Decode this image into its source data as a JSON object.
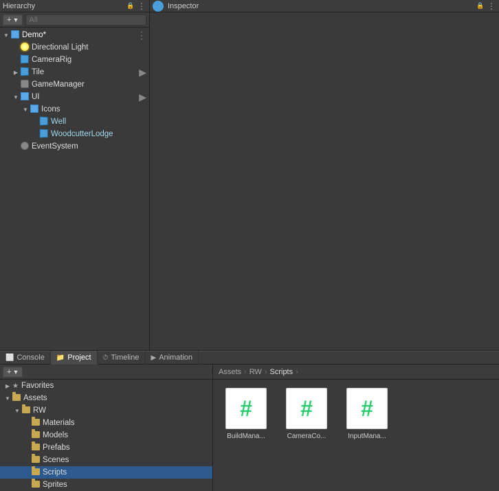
{
  "hierarchy": {
    "title": "Hierarchy",
    "search_placeholder": "All",
    "add_label": "+",
    "items": [
      {
        "id": "demo",
        "label": "Demo*",
        "level": 0,
        "icon": "cube-blue",
        "arrow": "open",
        "has_more": true
      },
      {
        "id": "directional-light",
        "label": "Directional Light",
        "level": 1,
        "icon": "light",
        "arrow": "empty"
      },
      {
        "id": "camera-rig",
        "label": "CameraRig",
        "level": 1,
        "icon": "cube",
        "arrow": "empty"
      },
      {
        "id": "tile",
        "label": "Tile",
        "level": 1,
        "icon": "cube",
        "arrow": "closed",
        "has_more": true
      },
      {
        "id": "game-manager",
        "label": "GameManager",
        "level": 1,
        "icon": "gameobj",
        "arrow": "empty"
      },
      {
        "id": "ui",
        "label": "UI",
        "level": 1,
        "icon": "cube-blue",
        "arrow": "open",
        "has_more": true
      },
      {
        "id": "icons",
        "label": "Icons",
        "level": 2,
        "icon": "cube-blue",
        "arrow": "open"
      },
      {
        "id": "well",
        "label": "Well",
        "level": 3,
        "icon": "cube",
        "arrow": "empty"
      },
      {
        "id": "woodcutter-lodge",
        "label": "WoodcutterLodge",
        "level": 3,
        "icon": "cube",
        "arrow": "empty"
      },
      {
        "id": "event-system",
        "label": "EventSystem",
        "level": 1,
        "icon": "eventsys",
        "arrow": "empty"
      }
    ]
  },
  "inspector": {
    "title": "Inspector"
  },
  "tabs": [
    {
      "id": "console",
      "label": "Console",
      "icon": "console"
    },
    {
      "id": "project",
      "label": "Project",
      "icon": "folder",
      "active": true
    },
    {
      "id": "timeline",
      "label": "Timeline",
      "icon": "timeline"
    },
    {
      "id": "animation",
      "label": "Animation",
      "icon": "animation"
    }
  ],
  "project": {
    "add_label": "+",
    "breadcrumb": [
      "Assets",
      "RW",
      "Scripts"
    ],
    "sidebar": {
      "favorites_label": "Favorites",
      "assets_label": "Assets",
      "rw_label": "RW",
      "folders": [
        {
          "id": "materials",
          "label": "Materials",
          "level": 1
        },
        {
          "id": "models",
          "label": "Models",
          "level": 1
        },
        {
          "id": "prefabs",
          "label": "Prefabs",
          "level": 1
        },
        {
          "id": "scenes",
          "label": "Scenes",
          "level": 1
        },
        {
          "id": "scripts",
          "label": "Scripts",
          "level": 1,
          "active": true
        },
        {
          "id": "sprites",
          "label": "Sprites",
          "level": 1
        }
      ]
    },
    "assets": [
      {
        "id": "build-manager",
        "label": "BuildMana..."
      },
      {
        "id": "camera-co",
        "label": "CameraCo..."
      },
      {
        "id": "input-manager",
        "label": "InputMana..."
      }
    ]
  }
}
